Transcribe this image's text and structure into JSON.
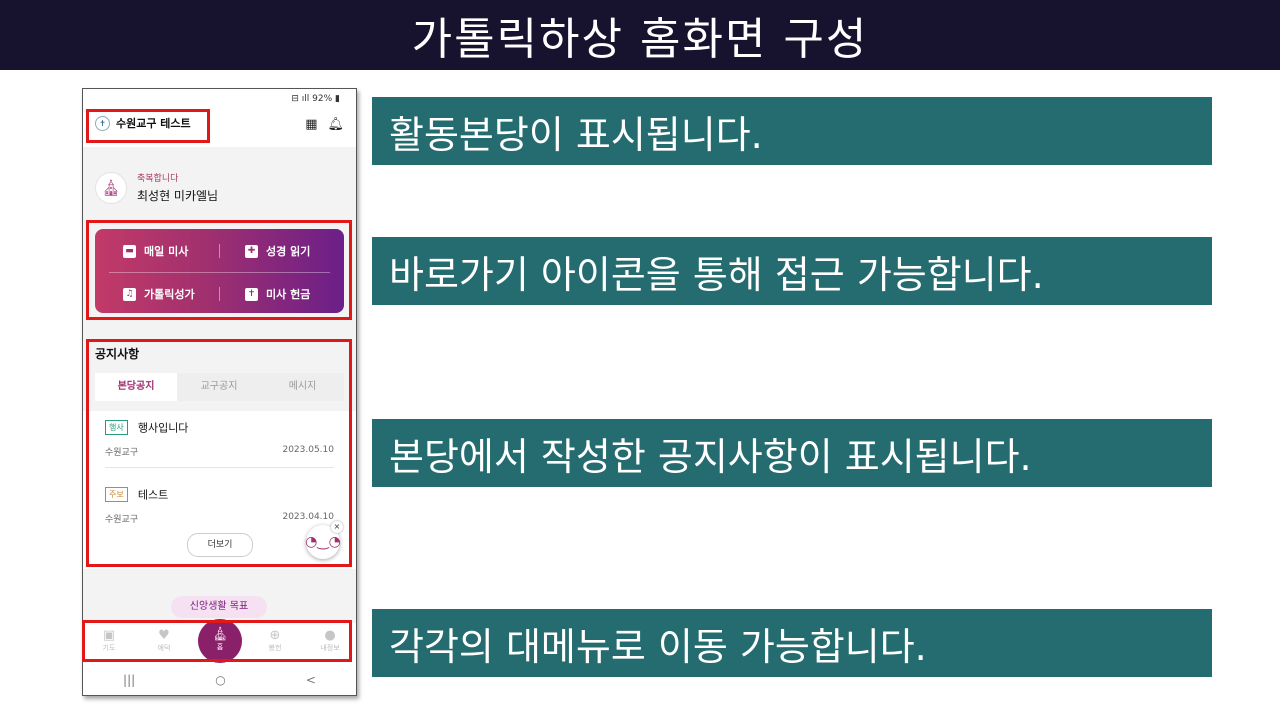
{
  "header": {
    "title": "가톨릭하상 홈화면 구성"
  },
  "phone": {
    "status": "92%",
    "parish_name": "수원교구 테스트",
    "greeting_small": "축복합니다",
    "greeting_name": "최성현 미카엘님",
    "shortcuts": [
      {
        "label": "매일 미사",
        "icon": "calendar-icon"
      },
      {
        "label": "성경 읽기",
        "icon": "bible-icon"
      },
      {
        "label": "가톨릭성가",
        "icon": "bell-icon"
      },
      {
        "label": "미사 헌금",
        "icon": "offering-icon"
      }
    ],
    "notice_title": "공지사항",
    "tabs": [
      "본당공지",
      "교구공지",
      "메시지"
    ],
    "active_tab": "본당공지",
    "notices": [
      {
        "badge": "행사",
        "badge_color": "#2a9a7a",
        "title": "행사입니다",
        "source": "수원교구",
        "date": "2023.05.10"
      },
      {
        "badge": "주보",
        "badge_color": "#c8862a",
        "title": "테스트",
        "source": "수원교구",
        "date": "2023.04.10"
      }
    ],
    "more_label": "더보기",
    "faith_goal_label": "신앙생활 목표",
    "bottom_nav": [
      {
        "label": "기도",
        "icon": "prayer-book-icon"
      },
      {
        "label": "애덕",
        "icon": "charity-icon"
      },
      {
        "label": "홈",
        "icon": "church-home-icon"
      },
      {
        "label": "봉헌",
        "icon": "offering-icon"
      },
      {
        "label": "내정보",
        "icon": "user-icon"
      }
    ],
    "system_nav": [
      "|||",
      "○",
      "<"
    ]
  },
  "callouts": [
    "활동본당이 표시됩니다.",
    "바로가기 아이콘을 통해 접근 가능합니다.",
    "본당에서 작성한 공지사항이 표시됩니다.",
    "각각의 대메뉴로 이동 가능합니다."
  ],
  "colors": {
    "title_bg": "#17122e",
    "callout_bg": "#256c70",
    "highlight": "#e21818",
    "accent": "#a0306f"
  }
}
